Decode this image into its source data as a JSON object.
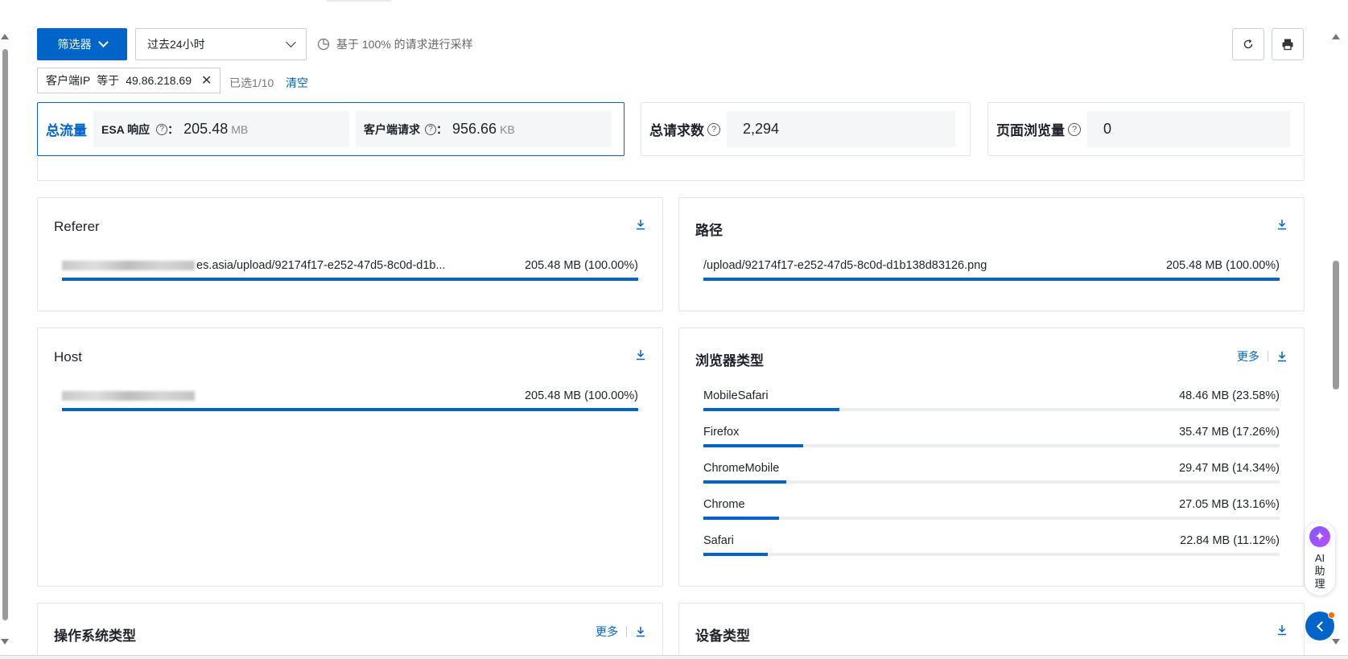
{
  "toolbar": {
    "filter_label": "筛选器",
    "time_range": "过去24小时",
    "sample_note": "基于 100% 的请求进行采样",
    "refresh_icon": "refresh-icon",
    "print_icon": "print-icon"
  },
  "active_filter": {
    "field": "客户端IP",
    "operator": "等于",
    "value": "49.86.218.69",
    "selected_count": "已选1/10",
    "clear_label": "清空"
  },
  "stats": {
    "total_traffic": {
      "title": "总流量",
      "esa_label": "ESA 响应",
      "esa_value": "205.48",
      "esa_unit": "MB",
      "client_label": "客户端请求",
      "client_value": "956.66",
      "client_unit": "KB"
    },
    "total_requests": {
      "title": "总请求数",
      "value": "2,294"
    },
    "page_views": {
      "title": "页面浏览量",
      "value": "0"
    }
  },
  "colon": "：",
  "panels": {
    "referer": {
      "title": "Referer",
      "rows": [
        {
          "name": "es.asia/upload/92174f17-e252-47d5-8c0d-d1b...",
          "value": "205.48 MB (100.00%)",
          "pct": 100
        }
      ]
    },
    "path": {
      "title": "路径",
      "rows": [
        {
          "name": "/upload/92174f17-e252-47d5-8c0d-d1b138d83126.png",
          "value": "205.48 MB (100.00%)",
          "pct": 100
        }
      ]
    },
    "host": {
      "title": "Host",
      "rows": [
        {
          "name": "",
          "value": "205.48 MB (100.00%)",
          "pct": 100
        }
      ]
    },
    "browser": {
      "title": "浏览器类型",
      "more_label": "更多",
      "rows": [
        {
          "name": "MobileSafari",
          "value": "48.46 MB (23.58%)",
          "pct": 23.58
        },
        {
          "name": "Firefox",
          "value": "35.47 MB (17.26%)",
          "pct": 17.26
        },
        {
          "name": "ChromeMobile",
          "value": "29.47 MB (14.34%)",
          "pct": 14.34
        },
        {
          "name": "Chrome",
          "value": "27.05 MB (13.16%)",
          "pct": 13.16
        },
        {
          "name": "Safari",
          "value": "22.84 MB (11.12%)",
          "pct": 11.12
        }
      ]
    },
    "os": {
      "title": "操作系统类型",
      "more_label": "更多"
    },
    "device": {
      "title": "设备类型"
    }
  },
  "ai_assistant": {
    "label": "AI助理"
  },
  "colors": {
    "primary": "#0064c8",
    "track": "#ebedf0",
    "border": "#e3e5e8"
  }
}
